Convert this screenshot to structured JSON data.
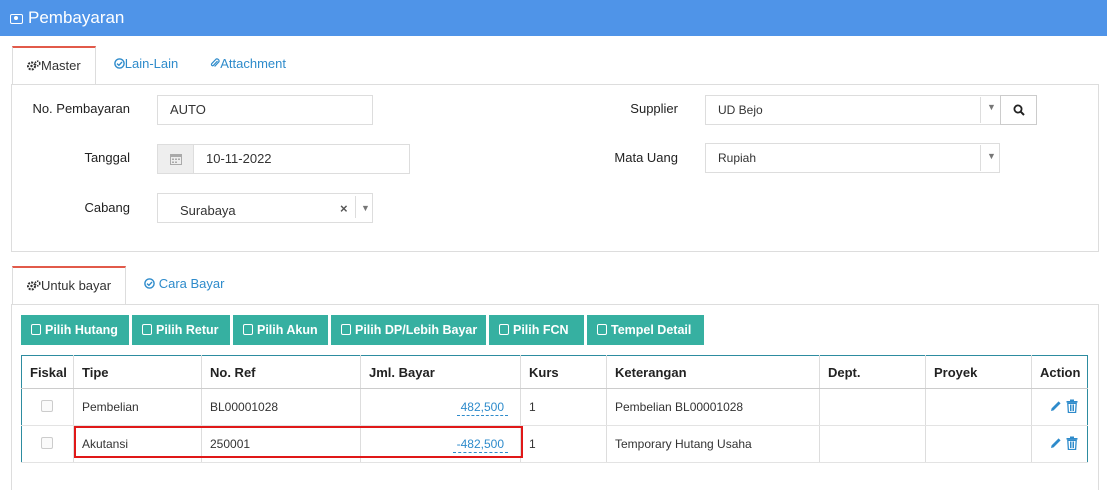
{
  "window": {
    "title": "Pembayaran",
    "title_icon": "camera-icon",
    "accent": "#4f94e8"
  },
  "top_tabs": [
    {
      "label": "Master",
      "icon": "gears-icon",
      "active": true
    },
    {
      "label": "Lain-Lain",
      "icon": "check-circle-icon",
      "active": false
    },
    {
      "label": "Attachment",
      "icon": "paperclip-icon",
      "active": false
    }
  ],
  "form": {
    "no_pembayaran": {
      "label": "No. Pembayaran",
      "value": "AUTO"
    },
    "tanggal": {
      "label": "Tanggal",
      "value": "10-11-2022",
      "icon": "calendar-icon"
    },
    "cabang": {
      "label": "Cabang",
      "value": "Surabaya",
      "clear": "×"
    },
    "supplier": {
      "label": "Supplier",
      "value": "UD Bejo",
      "icon": "search-icon"
    },
    "mata_uang": {
      "label": "Mata Uang",
      "value": "Rupiah"
    }
  },
  "bottom_tabs": [
    {
      "label": "Untuk bayar",
      "icon": "gears-icon",
      "active": true
    },
    {
      "label": "Cara Bayar",
      "icon": "check-circle-icon",
      "active": false
    }
  ],
  "action_buttons": [
    {
      "label": "Pilih Hutang"
    },
    {
      "label": "Pilih Retur"
    },
    {
      "label": "Pilih Akun"
    },
    {
      "label": "Pilih DP/Lebih Bayar"
    },
    {
      "label": "Pilih FCN"
    },
    {
      "label": "Tempel Detail"
    }
  ],
  "table": {
    "columns": [
      "Fiskal",
      "Tipe",
      "No. Ref",
      "Jml. Bayar",
      "Kurs",
      "Keterangan",
      "Dept.",
      "Proyek",
      "Action"
    ],
    "rows": [
      {
        "fiskal": false,
        "tipe": "Pembelian",
        "no_ref": "BL00001028",
        "jml_bayar": "482,500",
        "kurs": "1",
        "keterangan": "Pembelian BL00001028",
        "dept": "",
        "proyek": ""
      },
      {
        "fiskal": false,
        "tipe": "Akutansi",
        "no_ref": "250001",
        "jml_bayar": "-482,500",
        "kurs": "1",
        "keterangan": "Temporary Hutang Usaha",
        "dept": "",
        "proyek": ""
      }
    ]
  }
}
